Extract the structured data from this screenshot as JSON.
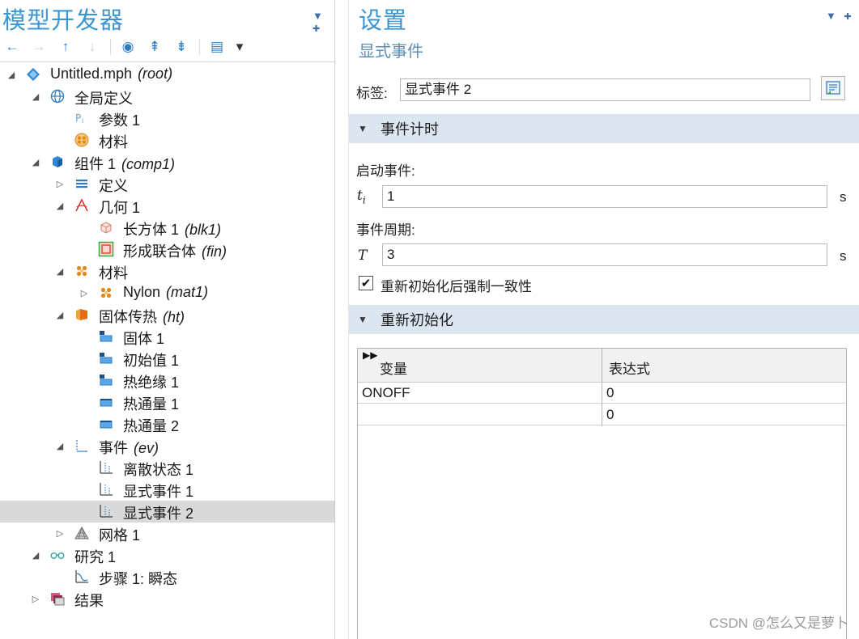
{
  "model_builder": {
    "title": "模型开发器",
    "ctrl_menu": "▼",
    "ctrl_pin": "✚",
    "toolbar": [
      {
        "name": "back-arrow-icon",
        "glyph": "←"
      },
      {
        "name": "forward-arrow-icon",
        "glyph": "→"
      },
      {
        "name": "move-up-icon",
        "glyph": "↑"
      },
      {
        "name": "move-down-icon",
        "glyph": "↓"
      },
      {
        "name": "show-icon",
        "glyph": "◉"
      },
      {
        "name": "collapse-all-icon",
        "glyph": "⇞"
      },
      {
        "name": "expand-all-icon",
        "glyph": "⇟"
      },
      {
        "name": "list-options-icon",
        "glyph": "▤"
      },
      {
        "name": "dropdown-icon",
        "glyph": "▾"
      }
    ],
    "tree": [
      {
        "label": "Untitled.mph",
        "tag": "(root)",
        "level": 0,
        "twisty": "open",
        "icon": "model-root-icon"
      },
      {
        "label": "全局定义",
        "tag": "",
        "level": 1,
        "twisty": "open",
        "icon": "global-definitions-icon"
      },
      {
        "label": "参数 1",
        "tag": "",
        "level": 2,
        "twisty": "none",
        "icon": "parameters-icon"
      },
      {
        "label": "材料",
        "tag": "",
        "level": 2,
        "twisty": "none",
        "icon": "materials-global-icon"
      },
      {
        "label": "组件 1",
        "tag": "(comp1)",
        "level": 1,
        "twisty": "open",
        "icon": "component-icon"
      },
      {
        "label": "定义",
        "tag": "",
        "level": 2,
        "twisty": "closed",
        "icon": "definitions-icon"
      },
      {
        "label": "几何 1",
        "tag": "",
        "level": 2,
        "twisty": "open",
        "icon": "geometry-icon"
      },
      {
        "label": "长方体 1",
        "tag": "(blk1)",
        "level": 3,
        "twisty": "none",
        "icon": "block-icon"
      },
      {
        "label": "形成联合体",
        "tag": "(fin)",
        "level": 3,
        "twisty": "none",
        "icon": "form-union-icon"
      },
      {
        "label": "材料",
        "tag": "",
        "level": 2,
        "twisty": "open",
        "icon": "materials-icon"
      },
      {
        "label": "Nylon",
        "tag": "(mat1)",
        "level": 3,
        "twisty": "closed",
        "icon": "material-nylon-icon"
      },
      {
        "label": "固体传热",
        "tag": "(ht)",
        "level": 2,
        "twisty": "open",
        "icon": "heat-transfer-icon"
      },
      {
        "label": "固体 1",
        "tag": "",
        "level": 3,
        "twisty": "none",
        "icon": "solid-icon"
      },
      {
        "label": "初始值 1",
        "tag": "",
        "level": 3,
        "twisty": "none",
        "icon": "initial-values-icon"
      },
      {
        "label": "热绝缘 1",
        "tag": "",
        "level": 3,
        "twisty": "none",
        "icon": "thermal-insulation-icon"
      },
      {
        "label": "热通量 1",
        "tag": "",
        "level": 3,
        "twisty": "none",
        "icon": "heat-flux-icon"
      },
      {
        "label": "热通量 2",
        "tag": "",
        "level": 3,
        "twisty": "none",
        "icon": "heat-flux-icon"
      },
      {
        "label": "事件",
        "tag": "(ev)",
        "level": 2,
        "twisty": "open",
        "icon": "events-icon"
      },
      {
        "label": "离散状态 1",
        "tag": "",
        "level": 3,
        "twisty": "none",
        "icon": "discrete-states-icon"
      },
      {
        "label": "显式事件 1",
        "tag": "",
        "level": 3,
        "twisty": "none",
        "icon": "explicit-event-icon"
      },
      {
        "label": "显式事件 2",
        "tag": "",
        "level": 3,
        "twisty": "none",
        "icon": "explicit-event-icon",
        "selected": true
      },
      {
        "label": "网格 1",
        "tag": "",
        "level": 2,
        "twisty": "closed",
        "icon": "mesh-icon"
      },
      {
        "label": "研究 1",
        "tag": "",
        "level": 1,
        "twisty": "open",
        "icon": "study-icon"
      },
      {
        "label": "步骤 1: 瞬态",
        "tag": "",
        "level": 2,
        "twisty": "none",
        "icon": "time-dependent-step-icon"
      },
      {
        "label": "结果",
        "tag": "",
        "level": 1,
        "twisty": "closed",
        "icon": "results-icon"
      }
    ]
  },
  "settings": {
    "title": "设置",
    "subtitle": "显式事件",
    "ctrl_menu": "▼",
    "ctrl_pin": "✚",
    "label_caption": "标签:",
    "label_value": "显式事件 2",
    "sections": {
      "event_timings": "事件计时",
      "reinitialization": "重新初始化"
    },
    "start_time_caption": "启动事件:",
    "start_time_symbol": "t",
    "start_time_sub": "i",
    "start_time_value": "1",
    "start_time_unit": "s",
    "period_caption": "事件周期:",
    "period_symbol": "T",
    "period_value": "3",
    "period_unit": "s",
    "checkbox_label": "重新初始化后强制一致性",
    "checkbox_checked": true,
    "table": {
      "headers": [
        "变量",
        "表达式"
      ],
      "rows": [
        [
          "ONOFF",
          "0"
        ],
        [
          "",
          "0"
        ]
      ]
    }
  },
  "watermark": "CSDN @怎么又是萝卜"
}
